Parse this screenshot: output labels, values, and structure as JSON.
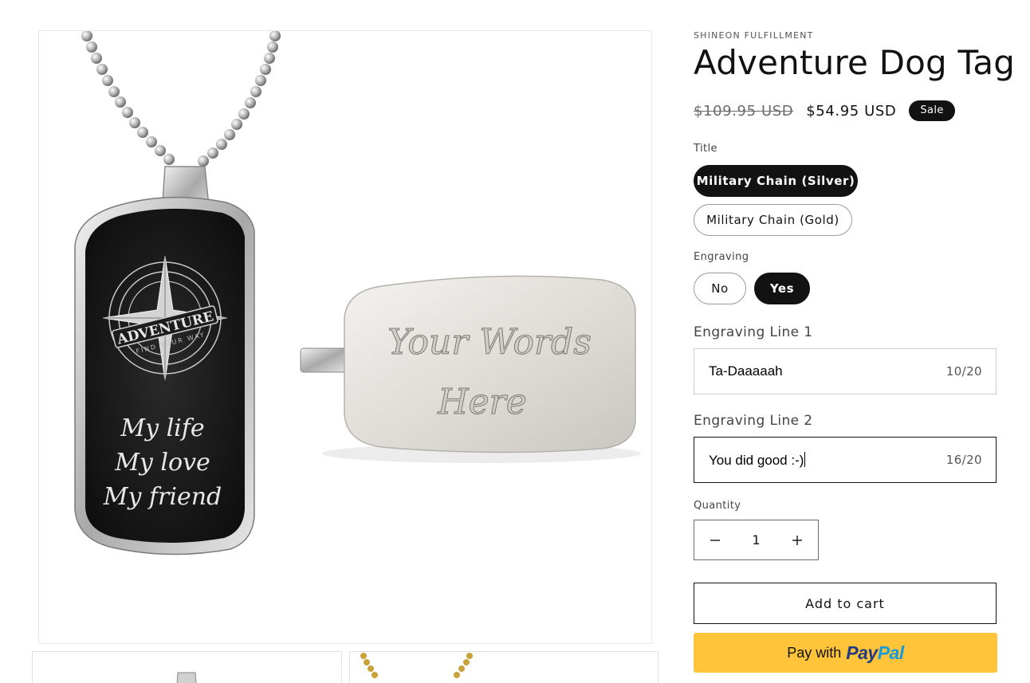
{
  "product": {
    "vendor": "SHINEON FULFILLMENT",
    "title": "Adventure Dog Tag",
    "price_compare": "$109.95 USD",
    "price_sale": "$54.95 USD",
    "sale_badge": "Sale"
  },
  "media": {
    "main_image_text": {
      "emblem_main": "ADVENTURE",
      "emblem_sub": "FIND YOUR WAY",
      "line1": "My life",
      "line2": "My love",
      "line3": "My friend",
      "back_line1": "Your Words",
      "back_line2": "Here"
    },
    "thumbnails": [
      {
        "alt": "Silver dog tag thumbnail"
      },
      {
        "alt": "Gold dog tag thumbnail"
      }
    ]
  },
  "options": {
    "title_label": "Title",
    "title_values": [
      "Military Chain (Silver)",
      "Military Chain (Gold)"
    ],
    "title_selected": "Military Chain (Silver)",
    "engraving_label": "Engraving",
    "engraving_values": [
      "No",
      "Yes"
    ],
    "engraving_selected": "Yes"
  },
  "engraving_fields": [
    {
      "label": "Engraving Line 1",
      "value": "Ta-Daaaaah",
      "counter": "10/20"
    },
    {
      "label": "Engraving Line 2",
      "value": "You did good :-)",
      "counter": "16/20"
    }
  ],
  "quantity": {
    "label": "Quantity",
    "value": "1",
    "decrease_icon": "minus-icon",
    "increase_icon": "plus-icon"
  },
  "actions": {
    "add_to_cart": "Add to cart",
    "paypal_prefix": "Pay with",
    "paypal_brand_a": "Pay",
    "paypal_brand_b": "Pal"
  },
  "colors": {
    "text": "#121212",
    "sale_badge_bg": "#121212",
    "paypal_bg": "#ffc439",
    "paypal_dark": "#253b80",
    "paypal_light": "#179bd7"
  }
}
